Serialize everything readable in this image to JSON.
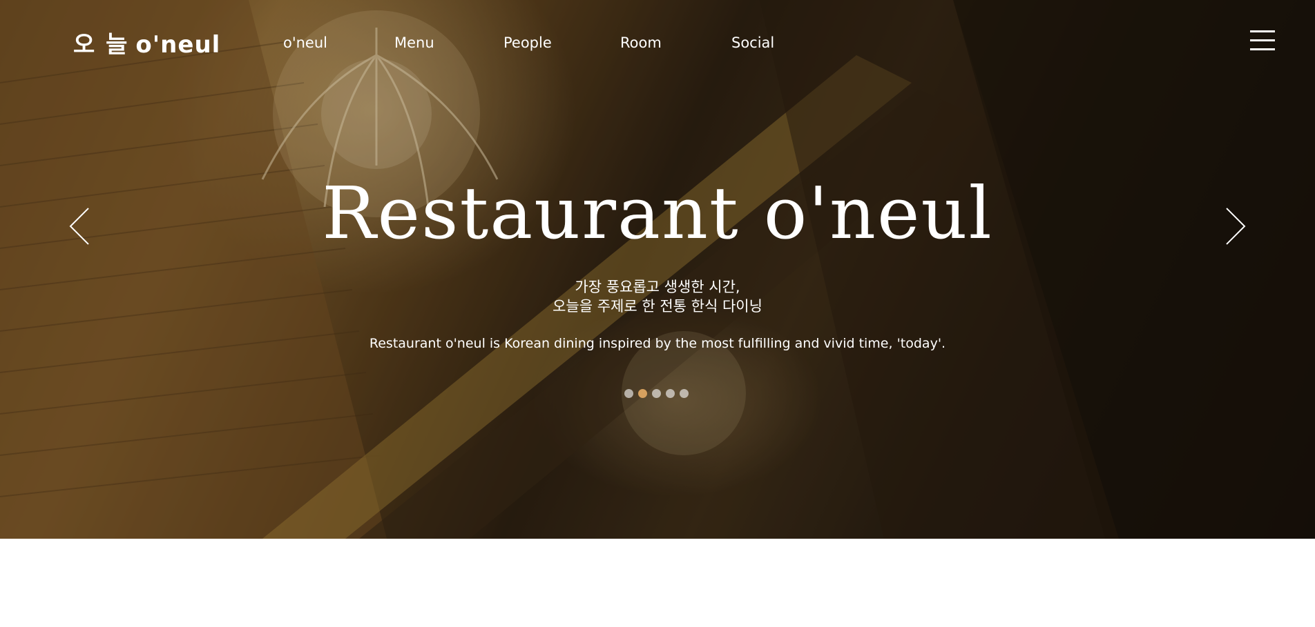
{
  "brand": {
    "logo_korean": "오 늘",
    "logo_english": "o'neul"
  },
  "nav": {
    "items": [
      {
        "label": "o'neul"
      },
      {
        "label": "Menu"
      },
      {
        "label": "People"
      },
      {
        "label": "Room"
      },
      {
        "label": "Social"
      }
    ]
  },
  "hero": {
    "title": "Restaurant o'neul",
    "subtitle_line1": "가장 풍요롭고 생생한 시간,",
    "subtitle_line2": "오늘을 주제로 한 전통 한식 다이닝",
    "description": "Restaurant o'neul is Korean dining inspired by the most fulfilling and vivid time, 'today'.",
    "slide_count": 5,
    "active_slide": 2
  },
  "icons": {
    "prev": "chevron-left-icon",
    "next": "chevron-right-icon",
    "menu": "hamburger-menu-icon"
  },
  "colors": {
    "text": "#ffffff",
    "active_dot": "#d7a15f"
  }
}
